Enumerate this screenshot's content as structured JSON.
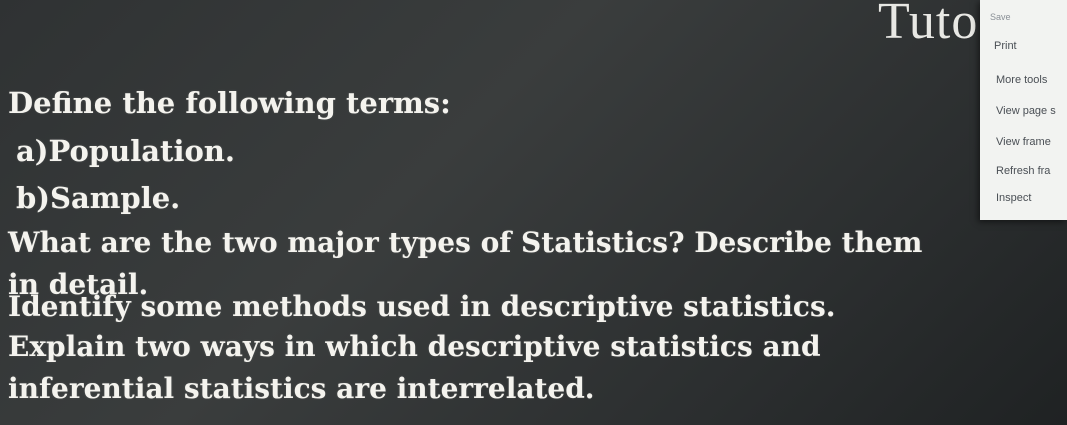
{
  "slide": {
    "header_fragment": "Tuto",
    "lines": [
      "Define the following terms:",
      "a)Population.",
      "b)Sample.",
      "What are the two major types of Statistics? Describe them",
      "in detail.",
      "Identify some methods used in descriptive statistics.",
      "Explain two ways in which descriptive statistics and",
      "inferential statistics are interrelated."
    ]
  },
  "context_menu": {
    "items": [
      "Save",
      "Print",
      "More tools",
      "View page s",
      "View frame",
      "Refresh fra",
      "Inspect"
    ]
  }
}
